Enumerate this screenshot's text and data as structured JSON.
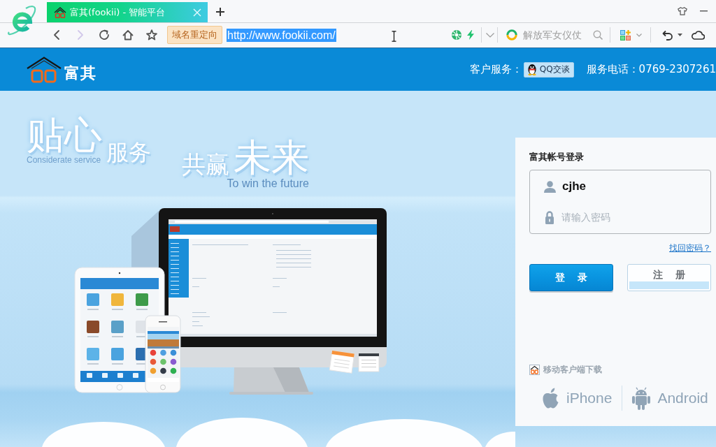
{
  "browser": {
    "tabs": [
      {
        "title": "富其(fookii) - 智能平台",
        "selected": true
      }
    ],
    "nav": [
      {
        "kind": "back",
        "disabled": false
      },
      {
        "kind": "forward",
        "disabled": true
      },
      {
        "kind": "refresh",
        "disabled": false
      },
      {
        "kind": "home",
        "disabled": false
      },
      {
        "kind": "favorite",
        "disabled": false
      }
    ],
    "address": {
      "tag": "域名重定向",
      "url": "http://www.fookii.com/",
      "url_selected": true
    },
    "search": {
      "placeholder": "解放军女仪仗"
    }
  },
  "header": {
    "logo_text": "富其",
    "service_label": "客户服务：",
    "qq_button": "QQ交谈",
    "phone": "服务电话：0769-2307261"
  },
  "hero": {
    "line1_large": "贴心",
    "line1_small": "服务",
    "line1_english": "Considerate service",
    "line2_small": "共赢",
    "line2_large": "未来",
    "line2_english": "To win the future"
  },
  "login": {
    "title": "富其帐号登录",
    "username": {
      "value": "cjhe"
    },
    "password": {
      "placeholder": "请输入密码"
    },
    "forgot_link": "找回密码？",
    "buttons": [
      {
        "kind": "primary",
        "label": "登 录"
      },
      {
        "kind": "secondary",
        "label": "注 册"
      }
    ],
    "mobile": {
      "title": "移动客户端下载",
      "platforms": [
        {
          "kind": "ios",
          "label": "iPhone"
        },
        {
          "kind": "android",
          "label": "Android"
        }
      ]
    }
  }
}
